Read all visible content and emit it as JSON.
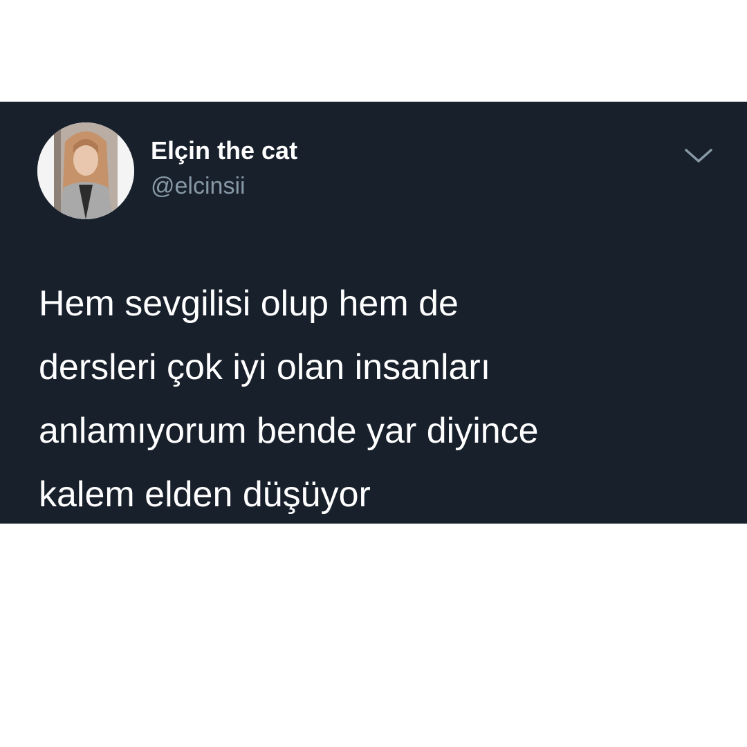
{
  "tweet": {
    "author": {
      "display_name": "Elçin the cat",
      "handle": "@elcinsii",
      "avatar_icon": "profile-photo"
    },
    "menu_icon": "chevron-down-icon",
    "text_lines": [
      "Hem sevgilisi olup hem de",
      "dersleri çok iyi olan insanları",
      "anlamıyorum bende yar diyince",
      "kalem elden düşüyor"
    ]
  },
  "colors": {
    "card_background": "#18202c",
    "page_background": "#ffffff",
    "primary_text": "#ffffff",
    "secondary_text": "#8899a6"
  }
}
